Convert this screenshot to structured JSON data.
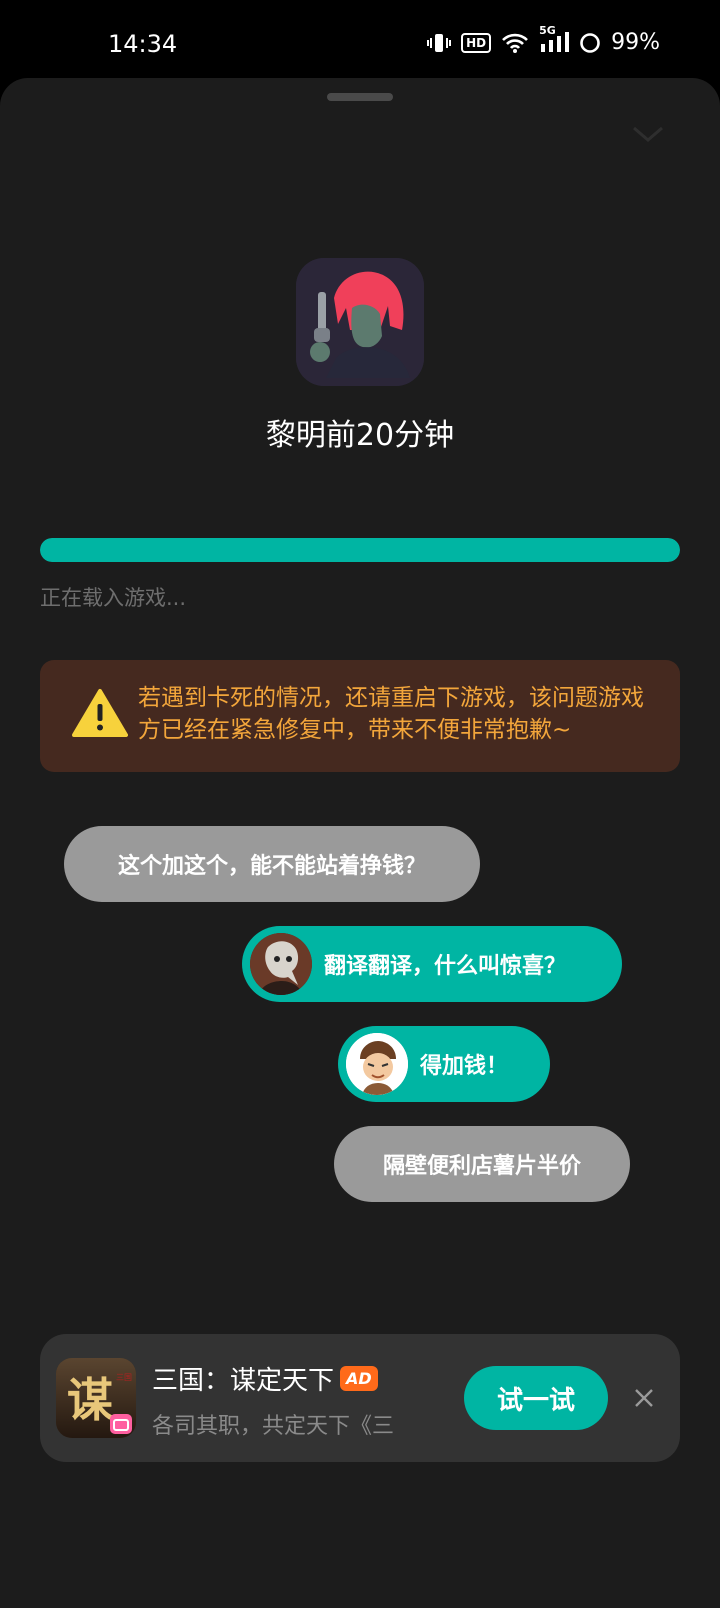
{
  "status": {
    "time": "14:34",
    "hd": "HD",
    "network": "5G",
    "battery": "99%",
    "icons": [
      "vibrate-icon",
      "hd-icon",
      "wifi-icon",
      "signal-5g-icon",
      "battery-icon"
    ]
  },
  "game": {
    "title": "黎明前20分钟",
    "icon": "game-cover-icon"
  },
  "loading": {
    "progress": 1.0,
    "text": "正在载入游戏..."
  },
  "notice": {
    "text": "若遇到卡死的情况，还请重启下游戏，该问题游戏方已经在紧急修复中，带来不便非常抱歉~",
    "icon": "warning-icon"
  },
  "comments": [
    {
      "text": "这个加这个，能不能站着挣钱？",
      "style": "gray"
    },
    {
      "text": "翻译翻译，什么叫惊喜？",
      "style": "teal",
      "avatar": "avatar-icon"
    },
    {
      "text": "得加钱！",
      "style": "teal",
      "avatar": "avatar-icon"
    },
    {
      "text": "隔壁便利店薯片半价",
      "style": "gray"
    }
  ],
  "ad": {
    "title": "三国：谋定天下",
    "badge": "AD",
    "description": "各司其职，共定天下《三",
    "cta": "试一试",
    "icon_char": "谋",
    "icon_sub": "三国"
  },
  "colors": {
    "accent": "#00b5a3",
    "sheet": "#1c1c1c",
    "warning_bg": "#45291f",
    "warning_text": "#f3a63b",
    "bubble_gray": "#9a9a9a",
    "ad_badge": "#ff6a1a"
  }
}
